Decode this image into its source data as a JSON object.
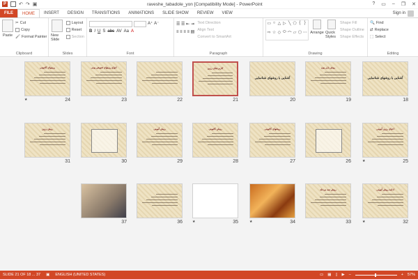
{
  "window": {
    "title": "raveshe_tabadole_yon [Compatibility Mode] - PowerPoint",
    "controls": [
      "?",
      "▭",
      "–",
      "❐",
      "✕"
    ]
  },
  "tabs": [
    "FILE",
    "HOME",
    "INSERT",
    "DESIGN",
    "TRANSITIONS",
    "ANIMATIONS",
    "SLIDE SHOW",
    "REVIEW",
    "VIEW"
  ],
  "active_tab": "HOME",
  "signin": "Sign in",
  "ribbon": {
    "clipboard": {
      "label": "Clipboard",
      "paste": "Paste",
      "cut": "Cut",
      "copy": "Copy",
      "format_painter": "Format Painter"
    },
    "slides": {
      "label": "Slides",
      "new_slide": "New Slide",
      "layout": "Layout",
      "reset": "Reset",
      "section": "Section"
    },
    "font": {
      "label": "Font",
      "buttons": [
        "B",
        "I",
        "U",
        "S",
        "abc",
        "AV",
        "Aa",
        "A"
      ]
    },
    "paragraph": {
      "label": "Paragraph",
      "text_direction": "Text Direction",
      "align_text": "Align Text",
      "convert": "Convert to SmartArt"
    },
    "drawing": {
      "label": "Drawing",
      "arrange": "Arrange",
      "quick_styles": "Quick Styles",
      "shape_fill": "Shape Fill",
      "shape_outline": "Shape Outline",
      "shape_effects": "Shape Effects"
    },
    "editing": {
      "label": "Editing",
      "find": "Find",
      "replace": "Replace",
      "select": "Select"
    }
  },
  "slides": [
    {
      "n": "18",
      "star": false,
      "kind": "big",
      "title": "آشنایی با روشهای شناسایی"
    },
    {
      "n": "19",
      "star": false,
      "kind": "text",
      "title": "روش بارز یون"
    },
    {
      "n": "20",
      "star": false,
      "kind": "big",
      "title": "آشنایی با روشهای شناسایی"
    },
    {
      "n": "21",
      "star": false,
      "kind": "text",
      "title": "کاربردهای رزین",
      "selected": true
    },
    {
      "n": "22",
      "star": false,
      "kind": "text",
      "title": ""
    },
    {
      "n": "23",
      "star": false,
      "kind": "text",
      "title": "انواع رزینهای تعویض یونی"
    },
    {
      "n": "24",
      "star": true,
      "kind": "text",
      "title": "رزینهای کاتیونی"
    },
    {
      "n": "25",
      "star": true,
      "kind": "text",
      "title": "احیای رزین آنیونی"
    },
    {
      "n": "26",
      "star": false,
      "kind": "diagram",
      "title": ""
    },
    {
      "n": "27",
      "star": false,
      "kind": "text",
      "title": "روشهای کاتیونی"
    },
    {
      "n": "28",
      "star": false,
      "kind": "text",
      "title": "روش کاتیونی"
    },
    {
      "n": "29",
      "star": false,
      "kind": "text",
      "title": "روش آنیونی"
    },
    {
      "n": "30",
      "star": false,
      "kind": "diagram",
      "title": ""
    },
    {
      "n": "31",
      "star": false,
      "kind": "text",
      "title": "روش رزین"
    },
    {
      "n": "32",
      "star": true,
      "kind": "text",
      "title": "ادامه روش آنیونی"
    },
    {
      "n": "33",
      "star": false,
      "kind": "text",
      "title": "روش سه مرحله"
    },
    {
      "n": "34",
      "star": true,
      "kind": "photo2",
      "title": ""
    },
    {
      "n": "35",
      "star": true,
      "kind": "white",
      "title": ""
    },
    {
      "n": "36",
      "star": false,
      "kind": "text",
      "title": ""
    },
    {
      "n": "37",
      "star": false,
      "kind": "photo",
      "title": ""
    }
  ],
  "status": {
    "slide": "SLIDE 21 OF 18 ... 37",
    "language": "ENGLISH (UNITED STATES)",
    "zoom": "57%"
  }
}
